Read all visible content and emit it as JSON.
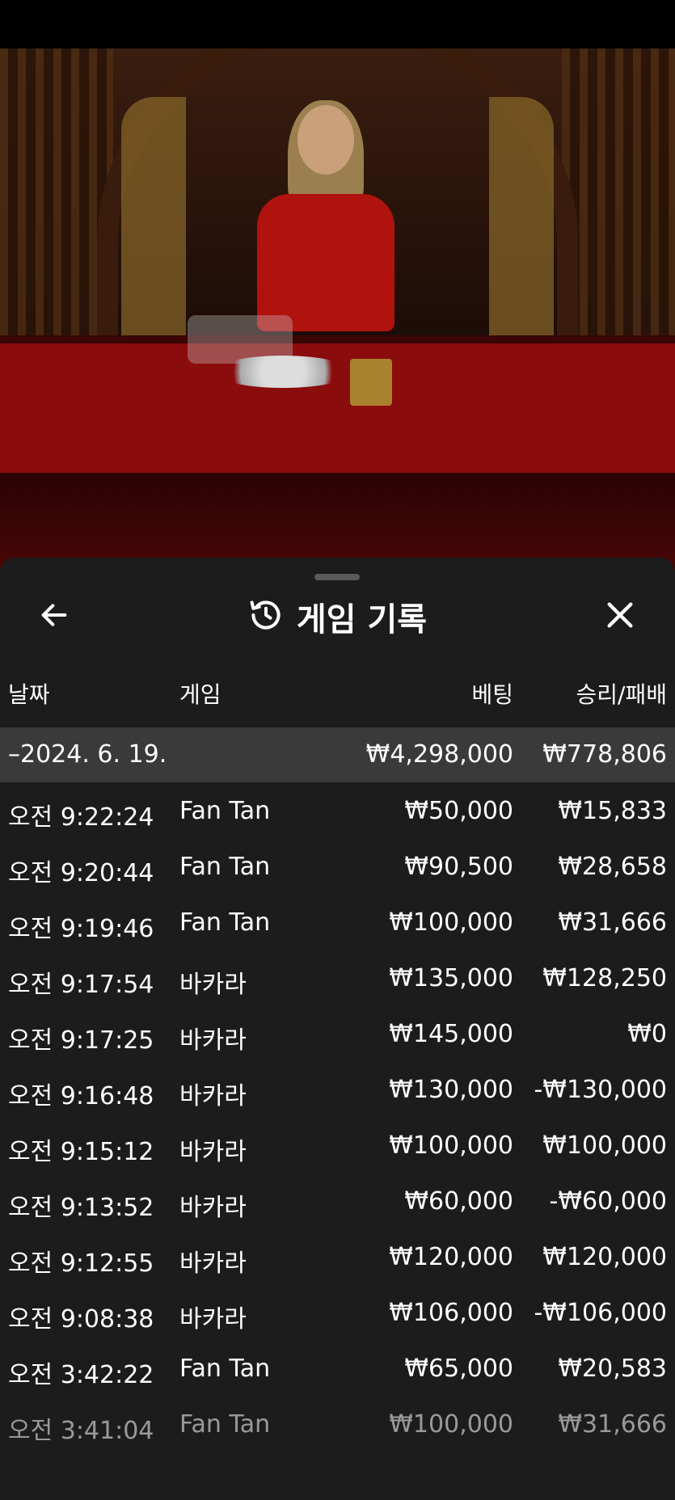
{
  "sheet": {
    "title": "게임 기록",
    "columns": {
      "date": "날짜",
      "game": "게임",
      "bet": "베팅",
      "winloss": "승리/패배"
    },
    "summary": {
      "date": "–2024. 6. 19.",
      "bet": "₩4,298,000",
      "winloss": "₩778,806"
    },
    "rows": [
      {
        "time": "오전 9:22:24",
        "game": "Fan Tan",
        "bet": "₩50,000",
        "winloss": "₩15,833"
      },
      {
        "time": "오전 9:20:44",
        "game": "Fan Tan",
        "bet": "₩90,500",
        "winloss": "₩28,658"
      },
      {
        "time": "오전 9:19:46",
        "game": "Fan Tan",
        "bet": "₩100,000",
        "winloss": "₩31,666"
      },
      {
        "time": "오전 9:17:54",
        "game": "바카라",
        "bet": "₩135,000",
        "winloss": "₩128,250"
      },
      {
        "time": "오전 9:17:25",
        "game": "바카라",
        "bet": "₩145,000",
        "winloss": "₩0"
      },
      {
        "time": "오전 9:16:48",
        "game": "바카라",
        "bet": "₩130,000",
        "winloss": "-₩130,000"
      },
      {
        "time": "오전 9:15:12",
        "game": "바카라",
        "bet": "₩100,000",
        "winloss": "₩100,000"
      },
      {
        "time": "오전 9:13:52",
        "game": "바카라",
        "bet": "₩60,000",
        "winloss": "-₩60,000"
      },
      {
        "time": "오전 9:12:55",
        "game": "바카라",
        "bet": "₩120,000",
        "winloss": "₩120,000"
      },
      {
        "time": "오전 9:08:38",
        "game": "바카라",
        "bet": "₩106,000",
        "winloss": "-₩106,000"
      },
      {
        "time": "오전 3:42:22",
        "game": "Fan Tan",
        "bet": "₩65,000",
        "winloss": "₩20,583"
      },
      {
        "time": "오전 3:41:04",
        "game": "Fan Tan",
        "bet": "₩100,000",
        "winloss": "₩31,666"
      }
    ]
  },
  "icons": {
    "back": "arrow-left-icon",
    "history": "history-clock-icon",
    "close": "close-icon"
  },
  "colors": {
    "sheet_bg": "#1c1c1c",
    "summary_bg": "#3a3a3a",
    "text": "#ffffff"
  }
}
